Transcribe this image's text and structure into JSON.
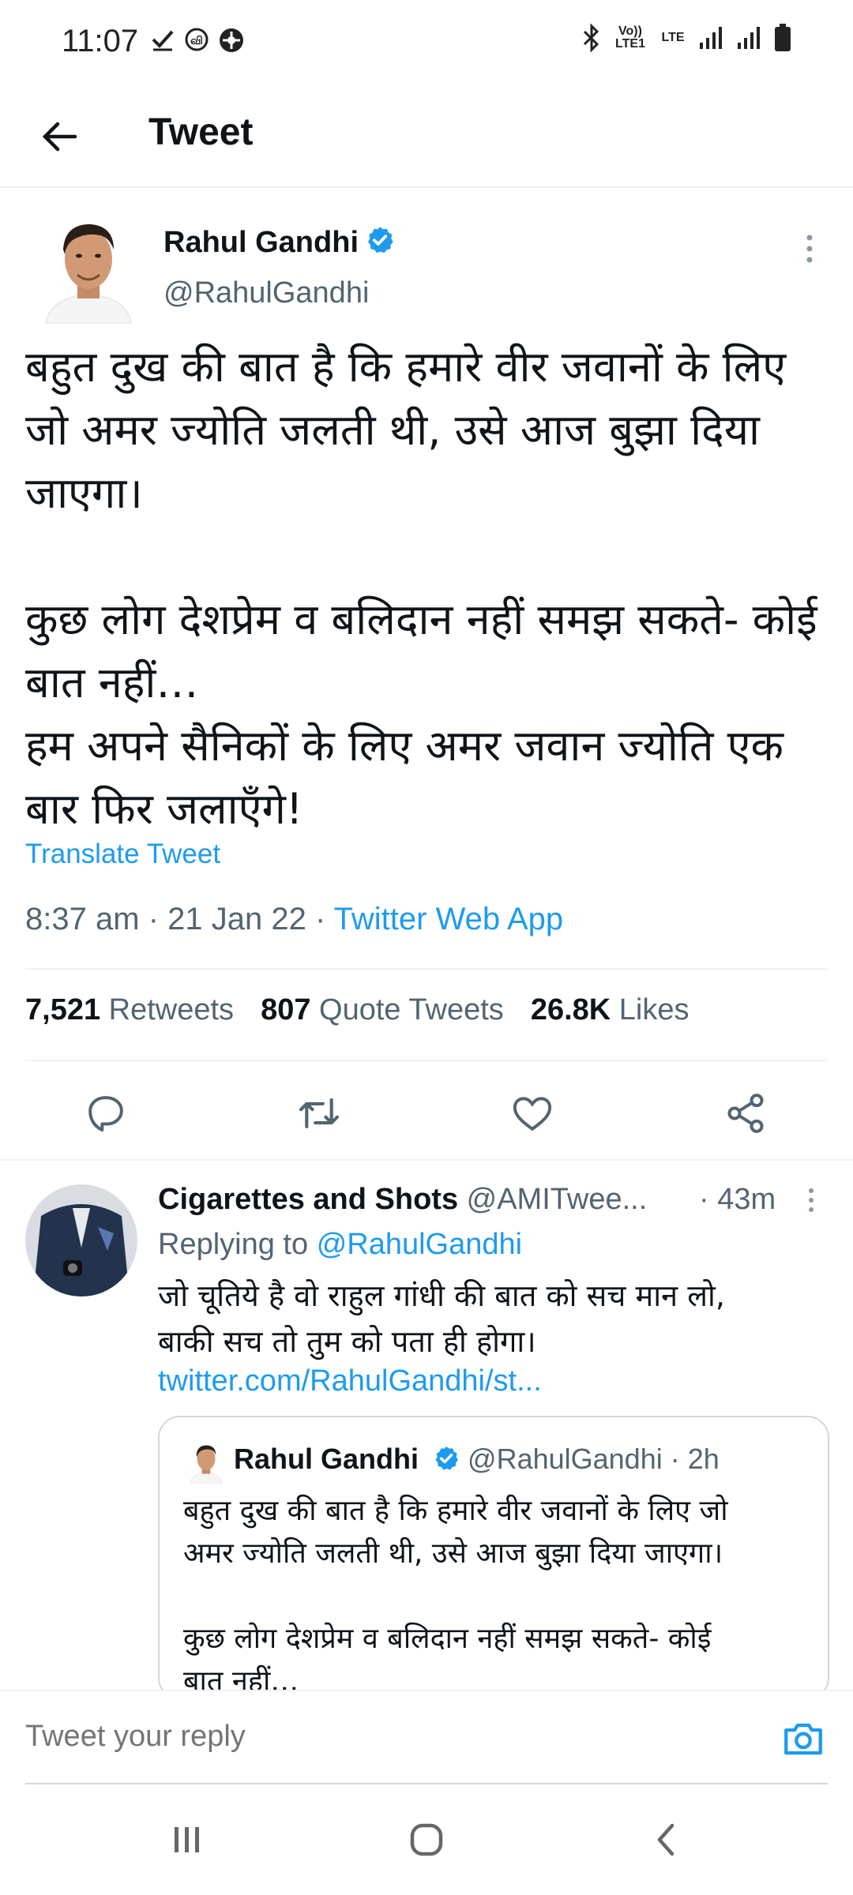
{
  "status_bar": {
    "time": "11:07",
    "left_icons": [
      "check-icon",
      "network-icon",
      "pinwheel-icon"
    ],
    "volte_label": "Vo)) LTE1",
    "lte_label": "LTE"
  },
  "header": {
    "title": "Tweet"
  },
  "main_tweet": {
    "author_name": "Rahul Gandhi",
    "author_handle": "@RahulGandhi",
    "text": "बहुत दुख की बात है कि हमारे वीर जवानों के लिए जो अमर ज्योति जलती थी, उसे आज बुझा दिया जाएगा।\n\nकुछ लोग देशप्रेम व बलिदान नहीं समझ सकते- कोई बात नहीं…\nहम अपने सैनिकों के लिए अमर जवान ज्योति एक बार फिर जलाएँगे!",
    "translate_label": "Translate Tweet",
    "time": "8:37 am",
    "date": "21 Jan 22",
    "source": "Twitter Web App",
    "separator": "·",
    "retweets_count": "7,521",
    "retweets_label": "Retweets",
    "quotes_count": "807",
    "quotes_label": "Quote Tweets",
    "likes_count": "26.8K",
    "likes_label": "Likes"
  },
  "reply": {
    "author_name": "Cigarettes and Shots",
    "author_handle": "@AMITwee...",
    "time": "· 43m",
    "replying_prefix": "Replying to",
    "replying_to": "@RahulGandhi",
    "text": "जो चूतिये है वो राहुल गांधी की बात को सच मान लो,\nबाकी सच तो तुम को पता ही होगा।",
    "link": "twitter.com/RahulGandhi/st...",
    "quote": {
      "author_name": "Rahul Gandhi",
      "author_handle": "@RahulGandhi",
      "time": "· 2h",
      "text": "बहुत दुख की बात है कि हमारे वीर जवानों के लिए जो\nअमर ज्योति जलती थी, उसे आज बुझा दिया जाएगा।\n\nकुछ लोग देशप्रेम व बलिदान नहीं समझ सकते- कोई\nबात नहीं…"
    }
  },
  "composer": {
    "placeholder": "Tweet your reply"
  },
  "colors": {
    "accent": "#1d9bf0",
    "secondary_text": "#536471",
    "divider": "#eff3f4"
  }
}
